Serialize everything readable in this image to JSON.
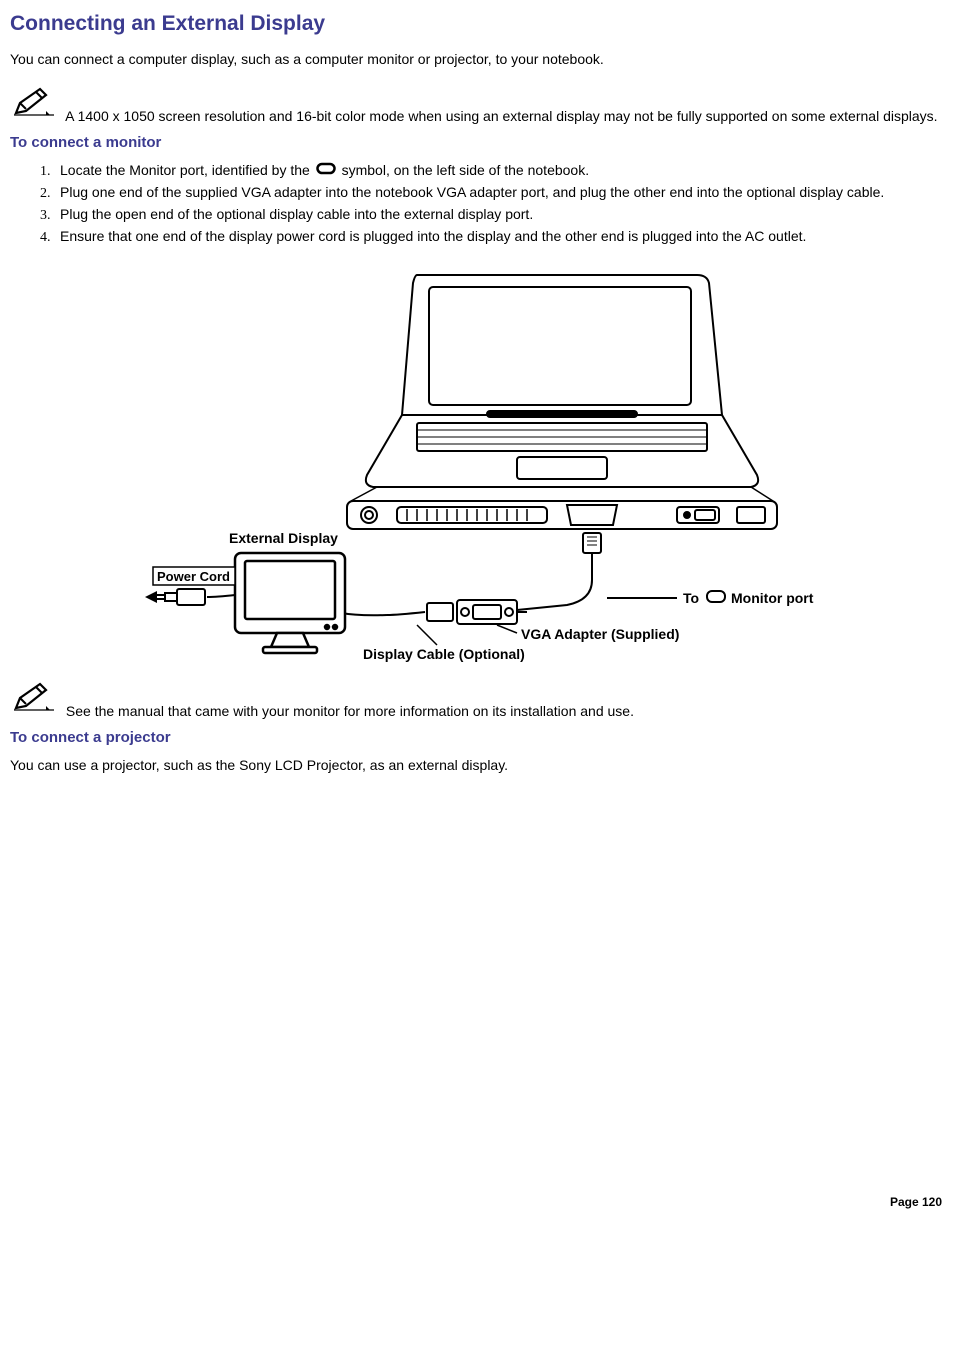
{
  "title": "Connecting an External Display",
  "intro": "You can connect a computer display, such as a computer monitor or projector, to your notebook.",
  "note1": "A 1400 x 1050 screen resolution and 16-bit color mode when using an external display may not be fully supported on some external displays.",
  "section_monitor": {
    "heading": "To connect a monitor",
    "step1_a": "Locate the Monitor port, identified by the ",
    "step1_b": "symbol, on the left side of the notebook.",
    "step2": "Plug one end of the supplied VGA adapter into the notebook VGA adapter port, and plug the other end into the optional display cable.",
    "step3": "Plug the open end of the optional display cable into the external display port.",
    "step4": "Ensure that one end of the display power cord is plugged into the display and the other end is plugged into the AC outlet."
  },
  "figure_labels": {
    "external_display": "External Display",
    "power_cord": "Power Cord",
    "to_monitor_port": "To",
    "monitor_port": "Monitor port",
    "vga_adapter": "VGA Adapter (Supplied)",
    "display_cable": "Display Cable (Optional)"
  },
  "note2": "See the manual that came with your monitor for more information on its installation and use.",
  "section_projector": {
    "heading": "To connect a projector",
    "text": "You can use a projector, such as the Sony LCD Projector, as an external display."
  },
  "page_number": "Page 120"
}
